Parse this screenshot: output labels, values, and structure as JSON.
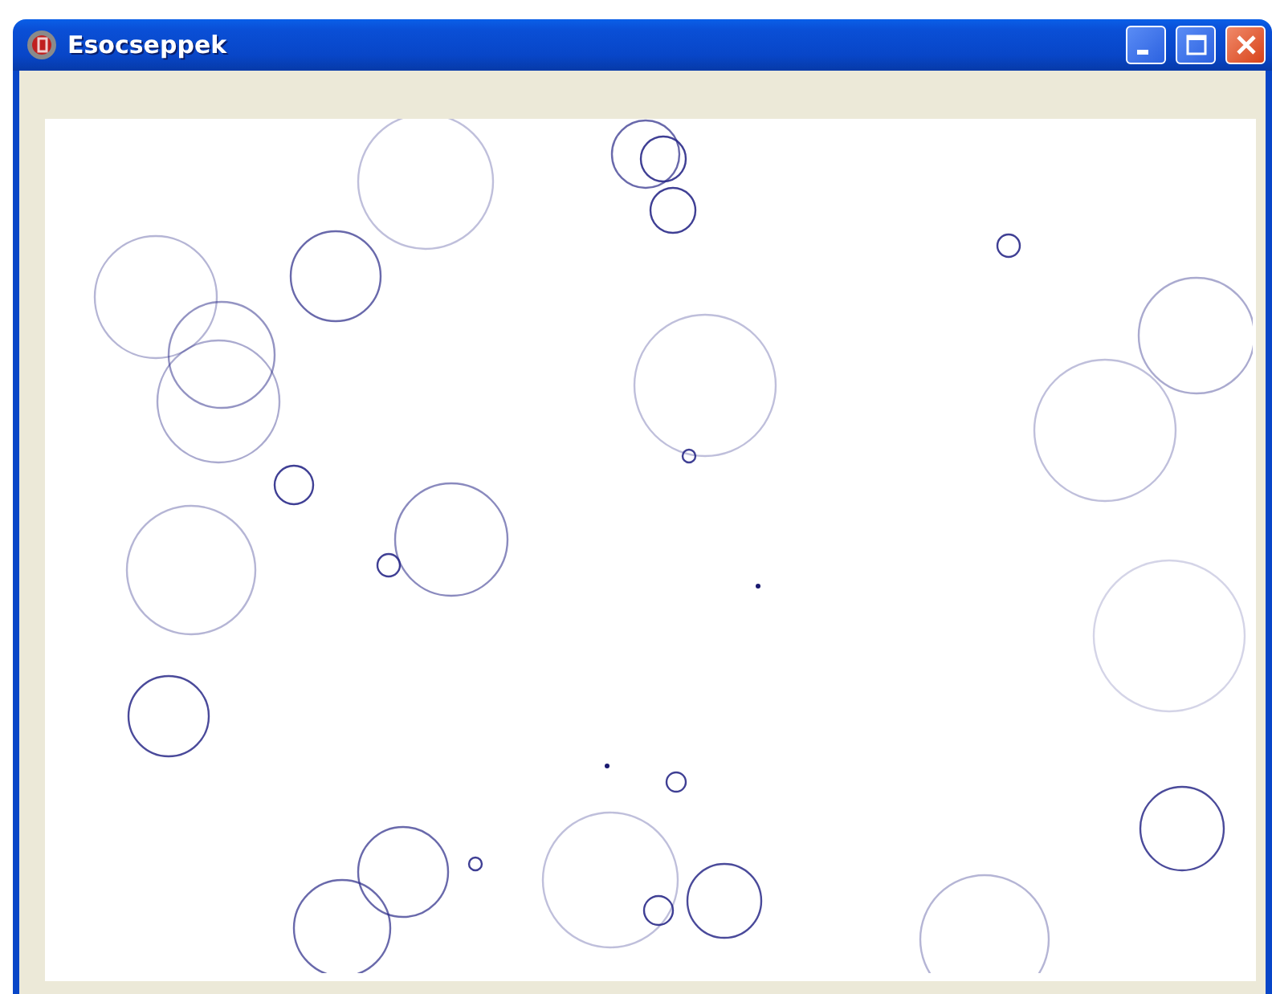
{
  "window": {
    "title": "Esocseppek"
  },
  "canvas": {
    "kind": "ripples"
  }
}
